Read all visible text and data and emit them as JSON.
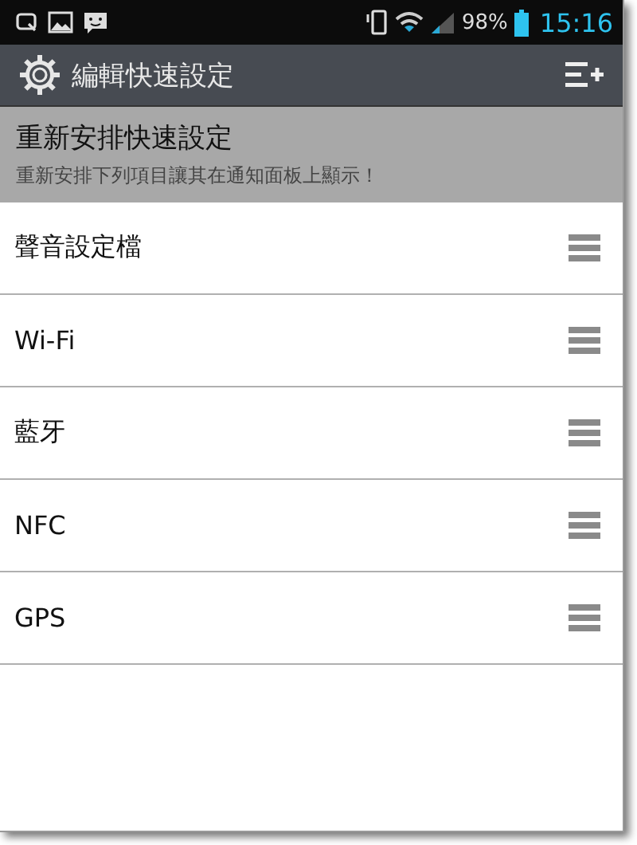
{
  "status_bar": {
    "battery": "98%",
    "time": "15:16"
  },
  "title_bar": {
    "title": "編輯快速設定"
  },
  "header": {
    "title": "重新安排快速設定",
    "subtitle": "重新安排下列項目讓其在通知面板上顯示！"
  },
  "items": [
    {
      "label": "聲音設定檔"
    },
    {
      "label": "Wi-Fi"
    },
    {
      "label": "藍牙"
    },
    {
      "label": "NFC"
    },
    {
      "label": "GPS"
    }
  ]
}
